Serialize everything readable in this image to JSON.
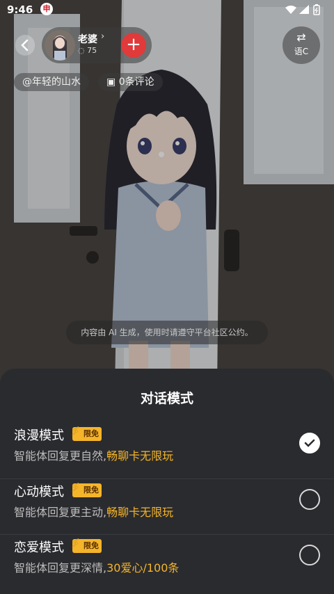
{
  "status_bar": {
    "time": "9:46",
    "app_icon_char": "申"
  },
  "header": {
    "bot_name": "老婆",
    "chat_count": "75",
    "translate_label": "语C"
  },
  "chips": {
    "author": "@年轻的山水",
    "comments": "0条评论"
  },
  "ai_notice": "内容由 AI 生成，使用时请遵守平台社区公约。",
  "sheet": {
    "title": "对话模式",
    "modes": [
      {
        "name": "浪漫模式",
        "badge": "限免",
        "desc_prefix": "智能体回复更自然,",
        "desc_highlight": "畅聊卡无限玩",
        "selected": true
      },
      {
        "name": "心动模式",
        "badge": "限免",
        "desc_prefix": "智能体回复更主动,",
        "desc_highlight": "畅聊卡无限玩",
        "selected": false
      },
      {
        "name": "恋爱模式",
        "badge": "限免",
        "desc_prefix": "智能体回复更深情,",
        "desc_highlight": "30爱心/100条",
        "selected": false
      }
    ]
  },
  "colors": {
    "accent": "#f5b52a",
    "sheet_bg": "#2a2b2f",
    "add_button": "#e03a3a"
  }
}
